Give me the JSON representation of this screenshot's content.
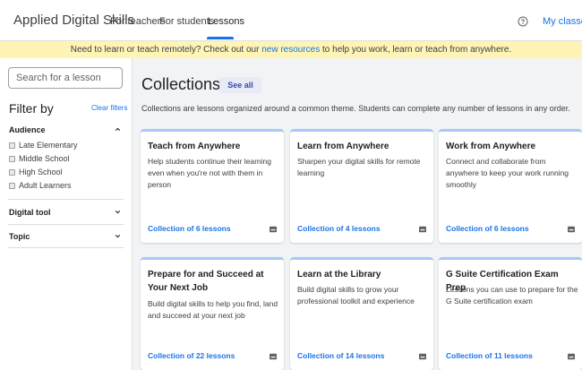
{
  "header": {
    "brand": "Applied Digital Skills",
    "nav": [
      {
        "label": "For teachers"
      },
      {
        "label": "For students"
      },
      {
        "label": "Lessons"
      }
    ],
    "my_classes": "My classes",
    "help_icon": "help-circle-icon"
  },
  "banner": {
    "before": "Need to learn or teach remotely? Check out our ",
    "link": "new resources",
    "after": " to help you work, learn or teach from anywhere."
  },
  "sidebar": {
    "search_placeholder": "Search for a lesson",
    "filter_title": "Filter by",
    "clear_filters": "Clear filters",
    "audience": {
      "title": "Audience",
      "options": [
        "Late Elementary",
        "Middle School",
        "High School",
        "Adult Learners"
      ]
    },
    "digital_tool": {
      "title": "Digital tool"
    },
    "topic": {
      "title": "Topic"
    }
  },
  "main": {
    "title": "Collections",
    "see_all": "See all",
    "description": "Collections are lessons organized around a common theme. Students can complete any number of lessons in any order.",
    "cards": [
      {
        "title": "Teach from Anywhere",
        "description": "Help students continue their learning even when you're not with them in person",
        "count": "Collection of 6 lessons"
      },
      {
        "title": "Learn from Anywhere",
        "description": "Sharpen your digital skills for remote learning",
        "count": "Collection of 4 lessons"
      },
      {
        "title": "Work from Anywhere",
        "description": "Connect and collaborate from anywhere to keep your work running smoothly",
        "count": "Collection of 6 lessons"
      },
      {
        "title": "Prepare for and Succeed at Your Next Job",
        "description": "Build digital skills to help you find, land and succeed at your next job",
        "count": "Collection of 22 lessons"
      },
      {
        "title": "Learn at the Library",
        "description": "Build digital skills to grow your professional toolkit and experience",
        "count": "Collection of 14 lessons"
      },
      {
        "title": "G Suite Certification Exam Prep",
        "description": "Lessons you can use to prepare for the G Suite certification exam",
        "count": "Collection of 11 lessons"
      }
    ]
  },
  "colors": {
    "accent": "#1a73e8",
    "banner_bg": "#fdf4b5",
    "main_bg": "#f1f3f4",
    "card_top": "#a8c7fa"
  }
}
